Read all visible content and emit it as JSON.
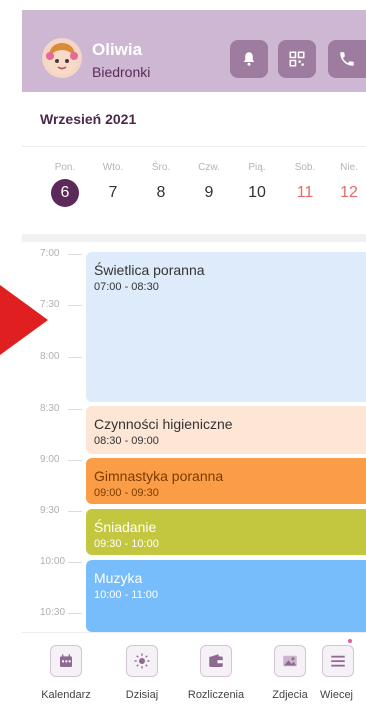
{
  "header": {
    "name": "Oliwia",
    "org": "Biedronki",
    "bg": "#cdb7d2",
    "buttons": [
      "bell-icon",
      "qr-icon",
      "phone-icon"
    ]
  },
  "calendar": {
    "month": "Wrzesień 2021",
    "days": [
      {
        "name": "Pon.",
        "date": "6"
      },
      {
        "name": "Wto.",
        "date": "7"
      },
      {
        "name": "Śro.",
        "date": "8"
      },
      {
        "name": "Czw.",
        "date": "9"
      },
      {
        "name": "Pią.",
        "date": "10"
      },
      {
        "name": "Sob.",
        "date": "11"
      },
      {
        "name": "Nie.",
        "date": "12"
      }
    ],
    "selected_day": "6"
  },
  "timeline": {
    "times": [
      "7:00",
      "7:30",
      "8:00",
      "8:30",
      "9:00",
      "9:30",
      "10:00",
      "10:30"
    ],
    "events": [
      {
        "title": "Świetlica poranna",
        "range": "07:00 - 08:30",
        "color": "#deebfb",
        "text_color": "#333333"
      },
      {
        "title": "Czynności higieniczne",
        "range": "08:30 - 09:00",
        "color": "#fde6d6",
        "text_color": "#333333"
      },
      {
        "title": "Gimnastyka poranna",
        "range": "09:00 - 09:30",
        "color": "#fa9d46",
        "text_color": "#7a3b00"
      },
      {
        "title": "Śniadanie",
        "range": "09:30 - 10:00",
        "color": "#c3c63f",
        "text_color": "#ffffff"
      },
      {
        "title": "Muzyka",
        "range": "10:00 - 11:00",
        "color": "#77bdfb",
        "text_color": "#ffffff"
      }
    ]
  },
  "nav": [
    {
      "label": "Kalendarz",
      "icon": "calendar-icon"
    },
    {
      "label": "Dzisiaj",
      "icon": "sun-icon"
    },
    {
      "label": "Rozliczenia",
      "icon": "wallet-icon"
    },
    {
      "label": "Zdjecia",
      "icon": "image-icon"
    },
    {
      "label": "Wiecej",
      "icon": "menu-icon"
    }
  ]
}
